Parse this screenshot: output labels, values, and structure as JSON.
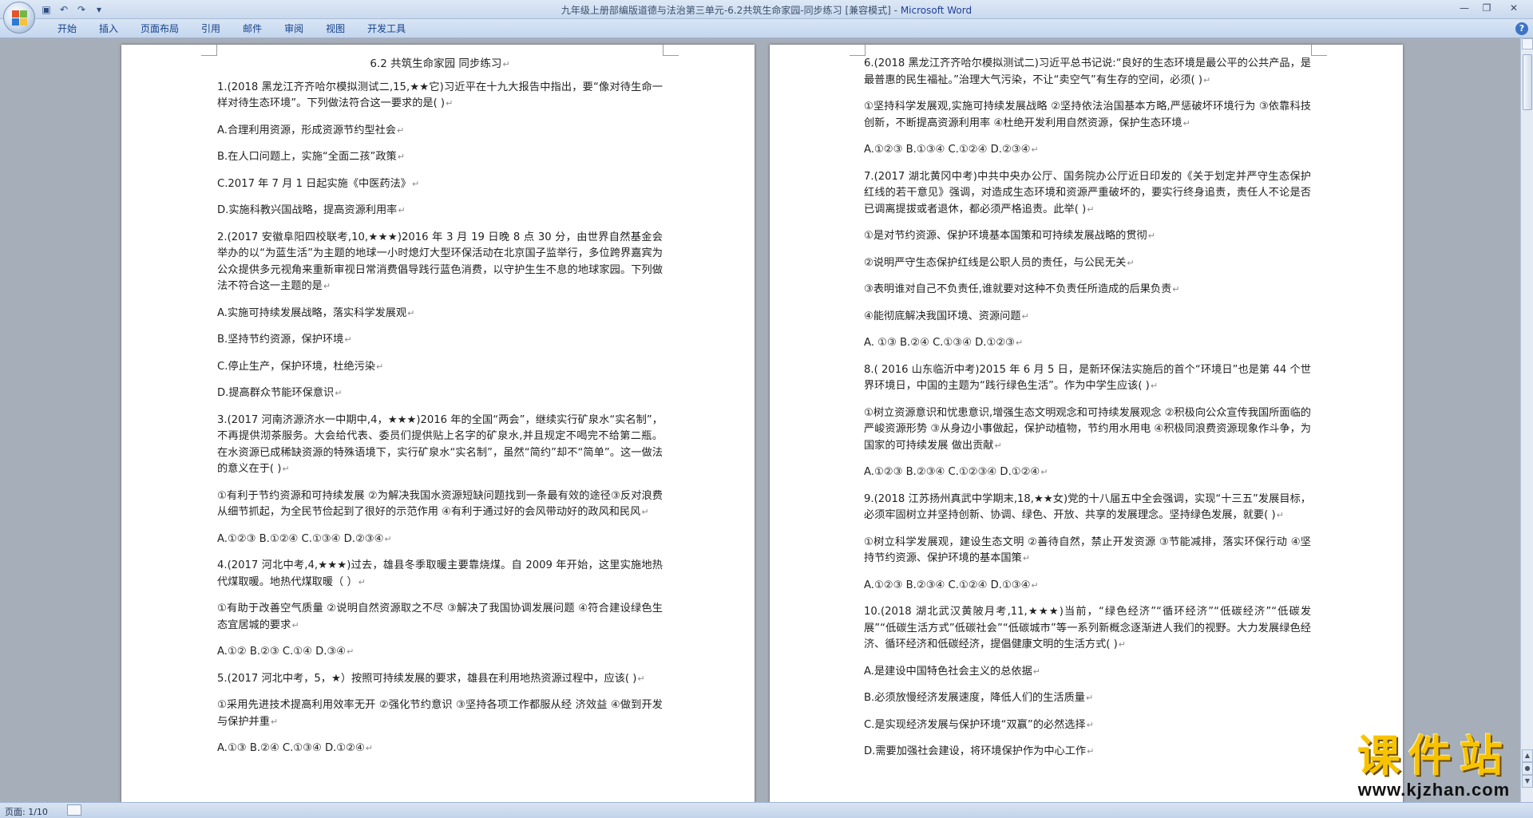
{
  "window": {
    "title": "九年级上册部编版道德与法治第三单元-6.2共筑生命家园-同步练习 [兼容模式]",
    "app_name": "Microsoft Word"
  },
  "ribbon": {
    "tabs": [
      "开始",
      "插入",
      "页面布局",
      "引用",
      "邮件",
      "审阅",
      "视图",
      "开发工具"
    ]
  },
  "document": {
    "title": "6.2  共筑生命家园  同步练习",
    "left_page": [
      "1.(2018 黑龙江齐齐哈尔模拟测试二,15,★★它)习近平在十九大报告中指出，要“像对待生命一样对待生态环境”。下列做法符合这一要求的是(        )",
      "A.合理利用资源，形成资源节约型社会",
      "B.在人口问题上，实施“全面二孩”政策",
      "C.2017 年 7 月 1 日起实施《中医药法》",
      "D.实施科教兴国战略，提高资源利用率",
      "2.(2017 安徽阜阳四校联考,10,★★★)2016 年 3 月 19 日晚 8 点 30 分，由世界自然基金会举办的以“为蓝生活”为主题的地球一小时熄灯大型环保活动在北京国子监举行，多位跨界嘉宾为公众提供多元视角来重新审视日常消费倡导践行蓝色消费，以守护生生不息的地球家园。下列做法不符合这一主题的是",
      "A.实施可持续发展战略，落实科学发展观",
      "B.坚持节约资源，保护环境",
      "C.停止生产，保护环境，杜绝污染",
      "D.提高群众节能环保意识",
      "3.(2017 河南济源济水一中期中,4，★★★)2016 年的全国“两会”，继续实行矿泉水“实名制”，不再提供沏茶服务。大会给代表、委员们提供贴上名字的矿泉水,并且规定不喝完不给第二瓶。在水资源已成稀缺资源的特殊语境下，实行矿泉水“实名制”，虽然“简约”却不“简单”。这一做法的意义在于(     )",
      "①有利于节约资源和可持续发展  ②为解决我国水资源短缺问题找到一条最有效的途径③反对浪费从细节抓起，为全民节俭起到了很好的示范作用  ④有利于通过好的会风带动好的政风和民风",
      "A.①②③    B.①②④    C.①③④    D.②③④",
      "4.(2017 河北中考,4,★★★)过去，雄县冬季取暖主要靠烧煤。自 2009 年开始，这里实施地热代煤取暖。地热代煤取暖（        ）",
      "①有助于改善空气质量    ②说明自然资源取之不尽    ③解决了我国协调发展问题    ④符合建设绿色生态宜居城的要求",
      "A.①②    B.②③    C.①④    D.③④",
      "5.(2017 河北中考，5，★）按照可持续发展的要求，雄县在利用地热资源过程中，应该(          )",
      "①采用先进技术提高利用效率无开    ②强化节约意识   ③坚持各项工作都服从经    济效益  ④做到开发与保护并重",
      "A.①③        B.②④     C.①③④     D.①②④"
    ],
    "right_page": [
      "6.(2018 黑龙江齐齐哈尔模拟测试二)习近平总书记说:“良好的生态环境是最公平的公共产品，是最普惠的民生福祉。”治理大气污染，不让“卖空气”有生存的空间，必须(         )",
      "①坚持科学发展观,实施可持续发展战略    ②坚持依法治国基本方略,严惩破坏环境行为  ③依靠科技创新，不断提高资源利用率   ④杜绝开发利用自然资源，保护生态环境",
      "A.①②③    B.①③④    C.①②④    D.②③④",
      "7.(2017 湖北黄冈中考)中共中央办公厅、国务院办公厅近日印发的《关于划定并严守生态保护红线的若干意见》强调，对造成生态环境和资源严重破坏的，要实行终身追责，责任人不论是否已调离提拔或者退休，都必须严格追责。此举(      )",
      "①是对节约资源、保护环境基本国策和可持续发展战略的贯彻",
      "②说明严守生态保护红线是公职人员的责任，与公民无关",
      "③表明谁对自己不负责任,谁就要对这种不负责任所造成的后果负责",
      "④能彻底解决我国环境、资源问题",
      "A.  ①③     B.②④     C.①③④     D.①②③",
      "8.( 2016 山东临沂中考)2015 年 6 月 5 日，是新环保法实施后的首个“环境日”也是第 44 个世界环境日，中国的主题为“践行绿色生活”。作为中学生应该(       )",
      "①树立资源意识和忧患意识,增强生态文明观念和可持续发展观念    ②积极向公众宣传我国所面临的严峻资源形势    ③从身边小事做起，保护动植物，节约用水用电    ④积极同浪费资源现象作斗争，为国家的可持续发展  做出贡献",
      "A.①②③  B.②③④   C.①②③④    D.①②④",
      "9.(2018  江苏扬州真武中学期末,18,★★女)党的十八届五中全会强调，实现“十三五”发展目标，必须牢固树立并坚持创新、协调、绿色、开放、共享的发展理念。坚持绿色发展，就要(         )",
      "①树立科学发展观，建设生态文明  ②善待自然，禁止开发资源  ③节能减排，落实环保行动   ④坚持节约资源、保护环境的基本国策",
      "A.①②③     B.②③④     C.①②④     D.①③④",
      "10.(2018 湖北武汉黄陂月考,11,★★★)当前，“绿色经济”“循环经济”“低碳经济”“低碳发展”“低碳生活方式”低碳社会”“低碳城市”等一系列新概念逐渐进人我们的视野。大力发展绿色经济、循环经济和低碳经济，提倡健康文明的生活方式(    )",
      "A.是建设中国特色社会主义的总依据",
      "B.必须放慢经济发展速度，降低人们的生活质量",
      "C.是实现经济发展与保护环境“双赢”的必然选择",
      "D.需要加强社会建设，将环境保护作为中心工作"
    ]
  },
  "status": {
    "page_label": "页面: 1/10"
  },
  "watermark": {
    "cn": "课件站",
    "url": "www.kjzhan.com"
  },
  "colors": {
    "ribbon_text": "#15428b",
    "workspace": "#a6aeb9",
    "watermark": "#f7c300"
  }
}
